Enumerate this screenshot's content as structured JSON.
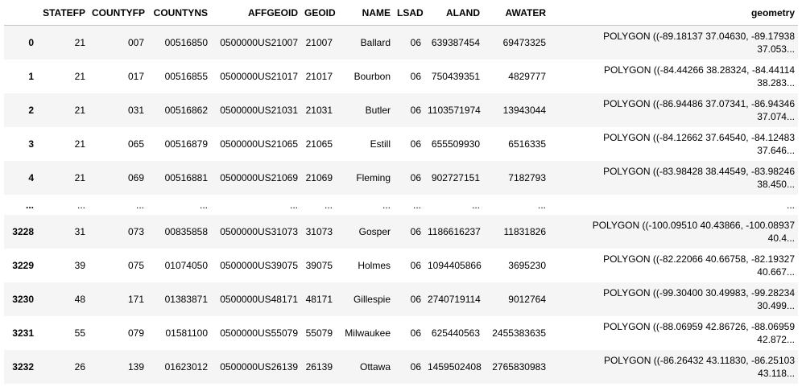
{
  "columns": [
    "",
    "STATEFP",
    "COUNTYFP",
    "COUNTYNS",
    "AFFGEOID",
    "GEOID",
    "NAME",
    "LSAD",
    "ALAND",
    "AWATER",
    "geometry"
  ],
  "rows": [
    {
      "idx": "0",
      "STATEFP": "21",
      "COUNTYFP": "007",
      "COUNTYNS": "00516850",
      "AFFGEOID": "0500000US21007",
      "GEOID": "21007",
      "NAME": "Ballard",
      "LSAD": "06",
      "ALAND": "639387454",
      "AWATER": "69473325",
      "geom1": "POLYGON ((-89.18137 37.04630, -89.17938",
      "geom2": "37.053..."
    },
    {
      "idx": "1",
      "STATEFP": "21",
      "COUNTYFP": "017",
      "COUNTYNS": "00516855",
      "AFFGEOID": "0500000US21017",
      "GEOID": "21017",
      "NAME": "Bourbon",
      "LSAD": "06",
      "ALAND": "750439351",
      "AWATER": "4829777",
      "geom1": "POLYGON ((-84.44266 38.28324, -84.44114",
      "geom2": "38.283..."
    },
    {
      "idx": "2",
      "STATEFP": "21",
      "COUNTYFP": "031",
      "COUNTYNS": "00516862",
      "AFFGEOID": "0500000US21031",
      "GEOID": "21031",
      "NAME": "Butler",
      "LSAD": "06",
      "ALAND": "1103571974",
      "AWATER": "13943044",
      "geom1": "POLYGON ((-86.94486 37.07341, -86.94346",
      "geom2": "37.074..."
    },
    {
      "idx": "3",
      "STATEFP": "21",
      "COUNTYFP": "065",
      "COUNTYNS": "00516879",
      "AFFGEOID": "0500000US21065",
      "GEOID": "21065",
      "NAME": "Estill",
      "LSAD": "06",
      "ALAND": "655509930",
      "AWATER": "6516335",
      "geom1": "POLYGON ((-84.12662 37.64540, -84.12483",
      "geom2": "37.646..."
    },
    {
      "idx": "4",
      "STATEFP": "21",
      "COUNTYFP": "069",
      "COUNTYNS": "00516881",
      "AFFGEOID": "0500000US21069",
      "GEOID": "21069",
      "NAME": "Fleming",
      "LSAD": "06",
      "ALAND": "902727151",
      "AWATER": "7182793",
      "geom1": "POLYGON ((-83.98428 38.44549, -83.98246",
      "geom2": "38.450..."
    },
    {
      "idx": "...",
      "STATEFP": "...",
      "COUNTYFP": "...",
      "COUNTYNS": "...",
      "AFFGEOID": "...",
      "GEOID": "...",
      "NAME": "...",
      "LSAD": "...",
      "ALAND": "...",
      "AWATER": "...",
      "geom1": "...",
      "geom2": ""
    },
    {
      "idx": "3228",
      "STATEFP": "31",
      "COUNTYFP": "073",
      "COUNTYNS": "00835858",
      "AFFGEOID": "0500000US31073",
      "GEOID": "31073",
      "NAME": "Gosper",
      "LSAD": "06",
      "ALAND": "1186616237",
      "AWATER": "11831826",
      "geom1": "POLYGON ((-100.09510 40.43866, -100.08937",
      "geom2": "40.4..."
    },
    {
      "idx": "3229",
      "STATEFP": "39",
      "COUNTYFP": "075",
      "COUNTYNS": "01074050",
      "AFFGEOID": "0500000US39075",
      "GEOID": "39075",
      "NAME": "Holmes",
      "LSAD": "06",
      "ALAND": "1094405866",
      "AWATER": "3695230",
      "geom1": "POLYGON ((-82.22066 40.66758, -82.19327",
      "geom2": "40.667..."
    },
    {
      "idx": "3230",
      "STATEFP": "48",
      "COUNTYFP": "171",
      "COUNTYNS": "01383871",
      "AFFGEOID": "0500000US48171",
      "GEOID": "48171",
      "NAME": "Gillespie",
      "LSAD": "06",
      "ALAND": "2740719114",
      "AWATER": "9012764",
      "geom1": "POLYGON ((-99.30400 30.49983, -99.28234",
      "geom2": "30.499..."
    },
    {
      "idx": "3231",
      "STATEFP": "55",
      "COUNTYFP": "079",
      "COUNTYNS": "01581100",
      "AFFGEOID": "0500000US55079",
      "GEOID": "55079",
      "NAME": "Milwaukee",
      "LSAD": "06",
      "ALAND": "625440563",
      "AWATER": "2455383635",
      "geom1": "POLYGON ((-88.06959 42.86726, -88.06959",
      "geom2": "42.872..."
    },
    {
      "idx": "3232",
      "STATEFP": "26",
      "COUNTYFP": "139",
      "COUNTYNS": "01623012",
      "AFFGEOID": "0500000US26139",
      "GEOID": "26139",
      "NAME": "Ottawa",
      "LSAD": "06",
      "ALAND": "1459502408",
      "AWATER": "2765830983",
      "geom1": "POLYGON ((-86.26432 43.11830, -86.25103",
      "geom2": "43.118..."
    }
  ]
}
